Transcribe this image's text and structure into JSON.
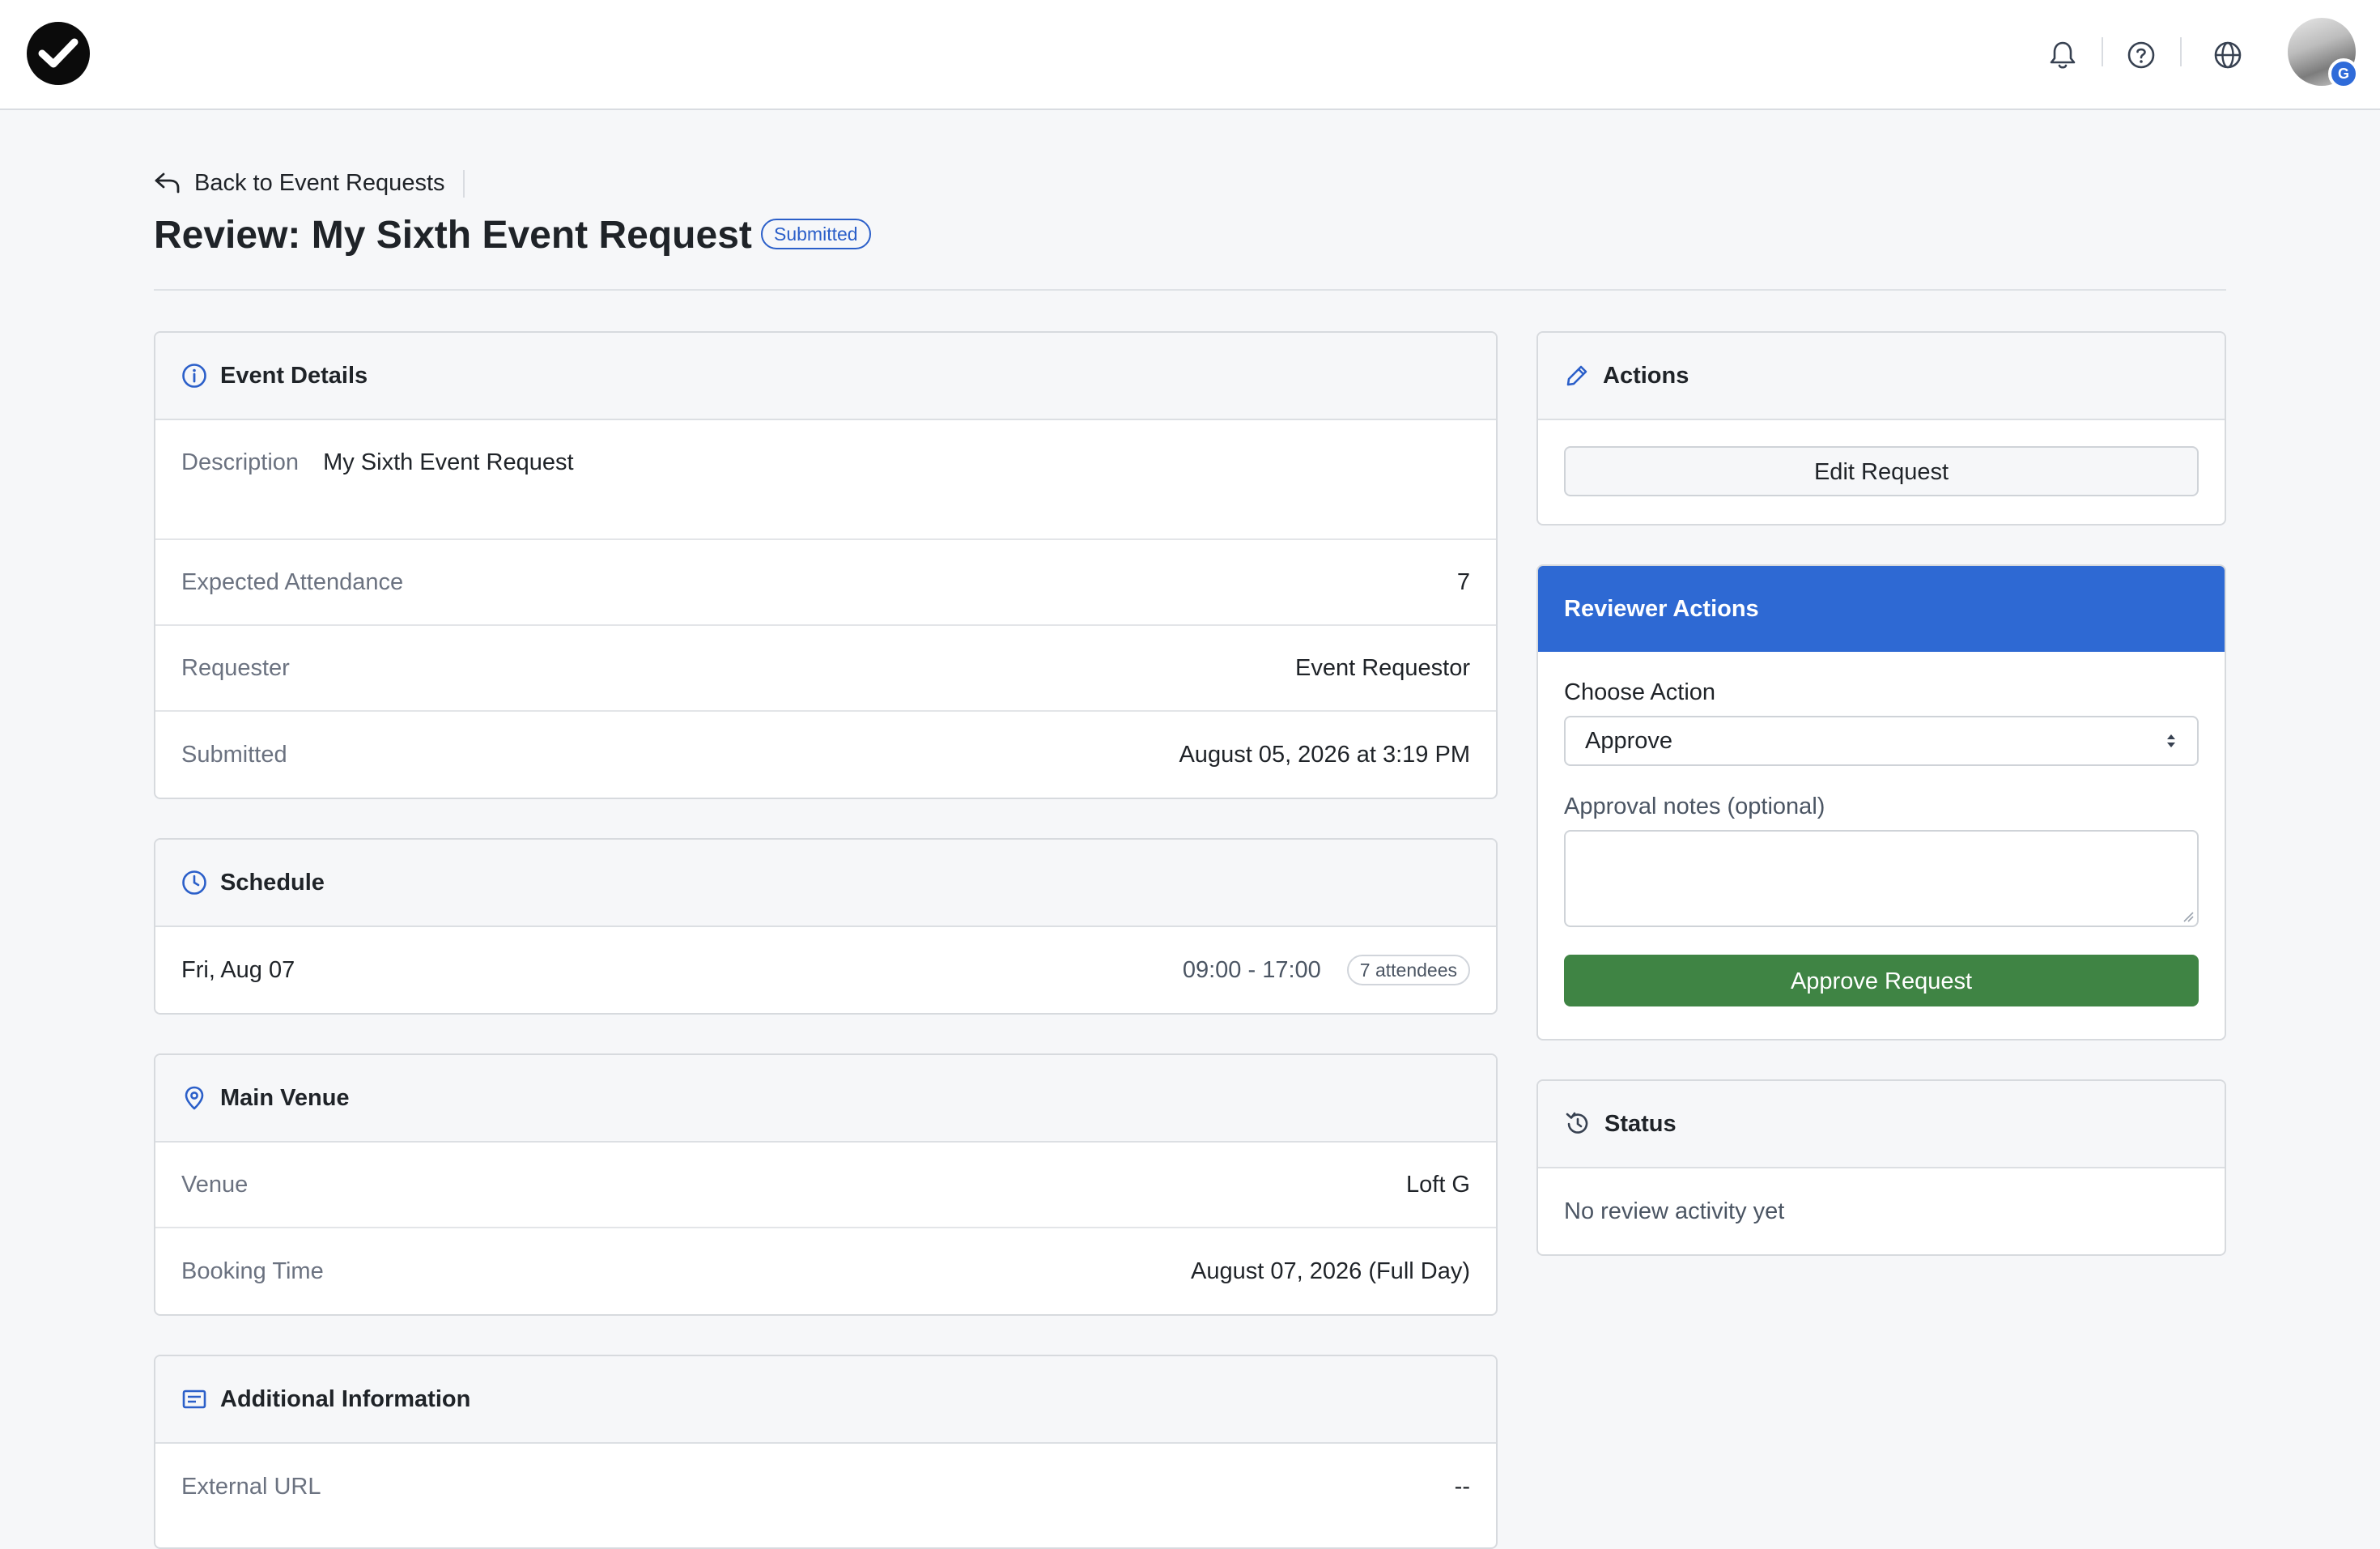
{
  "topbar": {
    "icons": [
      "bell-icon",
      "help-circle-icon",
      "globe-icon"
    ],
    "avatar_badge_letter": "G"
  },
  "header": {
    "back_label": "Back to Event Requests",
    "title": "Review: My Sixth Event Request",
    "status": "Submitted"
  },
  "event_details": {
    "title": "Event Details",
    "description_label": "Description",
    "description_value": "My Sixth Event Request",
    "rows": [
      {
        "label": "Expected Attendance",
        "value": "7"
      },
      {
        "label": "Requester",
        "value": "Event Requestor"
      },
      {
        "label": "Submitted",
        "value": "August 05, 2026 at 3:19 PM"
      }
    ]
  },
  "schedule": {
    "title": "Schedule",
    "day": "Fri, Aug 07",
    "time": "09:00 - 17:00",
    "attendees": "7 attendees"
  },
  "venue": {
    "title": "Main Venue",
    "rows": [
      {
        "label": "Venue",
        "value": "Loft G"
      },
      {
        "label": "Booking Time",
        "value": "August 07, 2026 (Full Day)"
      }
    ]
  },
  "additional": {
    "title": "Additional Information",
    "rows": [
      {
        "label": "External URL",
        "value": "--"
      }
    ]
  },
  "actions": {
    "title": "Actions",
    "edit_label": "Edit Request"
  },
  "reviewer": {
    "title": "Reviewer Actions",
    "choose_label": "Choose Action",
    "selected_action": "Approve",
    "notes_label": "Approval notes (optional)",
    "notes_value": "",
    "approve_label": "Approve Request"
  },
  "status_card": {
    "title": "Status",
    "message": "No review activity yet"
  },
  "colors": {
    "primary": "#2e69d3",
    "approve": "#3f8444",
    "badge": "#2b5fc9"
  }
}
